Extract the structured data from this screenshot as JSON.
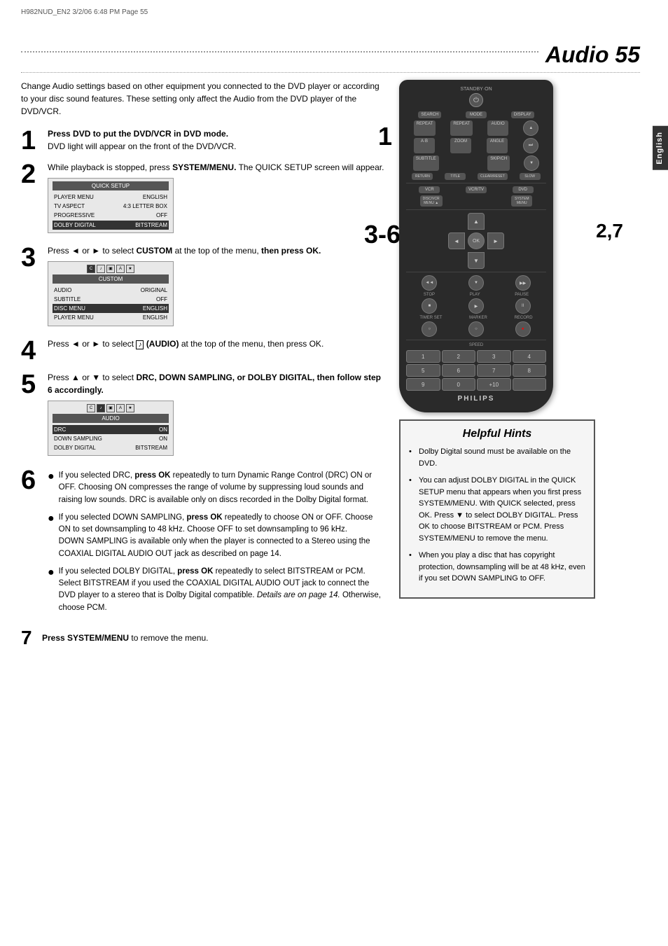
{
  "meta": {
    "file_info": "H982NUD_EN2  3/2/06  6:48 PM  Page 55"
  },
  "title": {
    "text": "Audio  55"
  },
  "english_tab": "English",
  "intro": "Change Audio settings based on other equipment you connected to the DVD player or according to your disc sound features. These setting only affect the Audio from the DVD player of the DVD/VCR.",
  "steps": [
    {
      "num": "1",
      "bold": "Press DVD to put the DVD/VCR in DVD mode.",
      "normal": "DVD light will appear on the front of the DVD/VCR."
    },
    {
      "num": "2",
      "bold_prefix": "While playback is stopped, press ",
      "bold": "SYSTEM/MENU.",
      "normal": " The QUICK SETUP screen will appear."
    }
  ],
  "step3": {
    "num": "3",
    "text": "Press ◄ or ► to select CUSTOM at the top of the menu, then press OK."
  },
  "step4": {
    "num": "4",
    "text": "Press ◄ or ► to select  (AUDIO) at the top of the menu, then press OK."
  },
  "step5": {
    "num": "5",
    "text": "Press ▲ or ▼ to select DRC, DOWN SAMPLING, or DOLBY DIGITAL, then follow step 6 accordingly."
  },
  "step6": {
    "num": "6",
    "bullets": [
      {
        "bold": "press OK",
        "prefix": "If you selected DRC, ",
        "text": " repeatedly to turn Dynamic Range Control (DRC) ON or OFF. Choosing ON compresses the range of volume by suppressing loud sounds and raising low sounds. DRC is available only on discs recorded in the Dolby Digital format."
      },
      {
        "bold": "press OK",
        "prefix": "If you selected DOWN SAMPLING, ",
        "text": " repeatedly to choose ON or OFF. Choose ON to set downsampling to 48 kHz. Choose OFF to set downsampling to 96 kHz.\nDOWN SAMPLING is available only when the player is connected to a Stereo using the COAXIAL DIGITAL AUDIO OUT jack as described on page 14."
      },
      {
        "bold": "press OK",
        "prefix": "If you selected DOLBY DIGITAL, ",
        "text": " repeatedly to select BITSTREAM or PCM. Select BITSTREAM if you used the COAXIAL DIGITAL AUDIO OUT jack to connect the DVD player to a stereo that is Dolby Digital compatible. ",
        "italic": "Details are on page 14.",
        "suffix": " Otherwise, choose PCM."
      }
    ]
  },
  "step7": {
    "num": "7",
    "bold": "Press SYSTEM/MENU",
    "text": " to remove the menu."
  },
  "screen1": {
    "title": "QUICK SETUP",
    "rows": [
      {
        "left": "PLAYER MENU",
        "right": "ENGLISH",
        "highlighted": false
      },
      {
        "left": "TV ASPECT",
        "right": "4:3 LETTER BOX",
        "highlighted": false
      },
      {
        "left": "PROGRESSIVE",
        "right": "OFF",
        "highlighted": false
      },
      {
        "left": "DOLBY DIGITAL",
        "right": "BITSTREAM",
        "highlighted": true
      }
    ]
  },
  "screen2": {
    "title": "CUSTOM",
    "rows": [
      {
        "left": "AUDIO",
        "right": "ORIGINAL",
        "highlighted": false
      },
      {
        "left": "SUBTITLE",
        "right": "OFF",
        "highlighted": false
      },
      {
        "left": "DISC MENU",
        "right": "ENGLISH",
        "highlighted": false
      },
      {
        "left": "PLAYER MENU",
        "right": "ENGLISH",
        "highlighted": false
      }
    ]
  },
  "screen3": {
    "title": "AUDIO",
    "rows": [
      {
        "left": "DRC",
        "right": "ON",
        "highlighted": true
      },
      {
        "left": "DOWN SAMPLING",
        "right": "ON",
        "highlighted": false
      },
      {
        "left": "DOLBY DIGITAL",
        "right": "BITSTREAM",
        "highlighted": false
      }
    ]
  },
  "remote": {
    "standby_label": "STANDBY·ON",
    "buttons_row1": [
      "SEARCH",
      "MODE",
      "DISPLAY"
    ],
    "buttons_row2": [
      "REPEAT",
      "REPEAT",
      "AUDIO"
    ],
    "buttons_row3": [
      "A·B",
      "ZOOM",
      "ANGLE"
    ],
    "buttons_row4": [
      "SUBTITLE",
      "",
      "SKIP/CH"
    ],
    "buttons_row5": [
      "RETURN",
      "TITLE",
      "CLEAR/RESET",
      "SLOW"
    ],
    "mode_btns": [
      "VCR",
      "VCR/TV",
      "DVD"
    ],
    "menu_btns": [
      "DISC/VCR MENU",
      "SYSTEM MENU"
    ],
    "dpad_ok": "OK",
    "transport": [
      "◄◄",
      "▶",
      "▶▶",
      "■",
      "▶",
      "II"
    ],
    "labels_transport": [
      "STOP",
      "PLAY",
      "PAUSE",
      "TIMER SET",
      "MARKER",
      "RECORD"
    ],
    "speed_label": "SPEED",
    "numpad": [
      "1",
      "2",
      "3",
      "4",
      "5",
      "6",
      "7",
      "8",
      "9",
      "0",
      "+10"
    ],
    "philips": "PHILIPS"
  },
  "step_labels_on_remote": {
    "label1": "1",
    "label36": "3-6",
    "label27": "2,7"
  },
  "helpful_hints": {
    "title": "Helpful Hints",
    "items": [
      "Dolby Digital sound must be available on the DVD.",
      "You can adjust DOLBY DIGITAL in the QUICK SETUP menu that appears when you first press SYSTEM/MENU. With QUICK selected, press OK. Press ▼ to select DOLBY DIGITAL. Press OK to choose BITSTREAM or PCM. Press SYSTEM/MENU to remove the menu.",
      "When you play a disc that has copyright protection, downsampling will be at 48 kHz, even if you set DOWN SAMPLING to OFF."
    ]
  }
}
